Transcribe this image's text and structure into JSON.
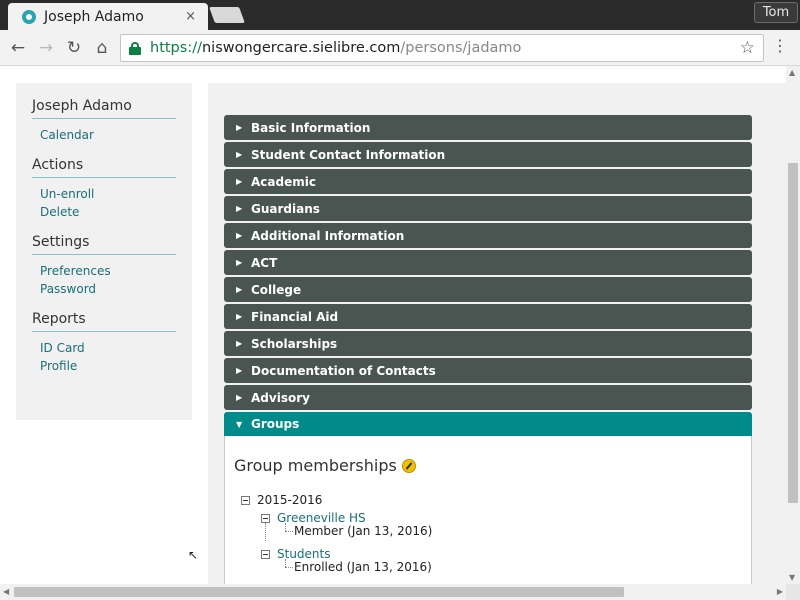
{
  "browser": {
    "tab_title": "Joseph Adamo",
    "tab_close": "×",
    "profile": "Tom",
    "url_scheme": "https://",
    "url_host": "niswongercare.sielibre.com",
    "url_path": "/persons/jadamo",
    "icons": {
      "back": "←",
      "forward": "→",
      "reload": "↻",
      "home": "⌂",
      "star": "☆",
      "menu": "⋮"
    }
  },
  "sidebar": {
    "sections": [
      {
        "heading": "Joseph Adamo",
        "links": [
          "Calendar"
        ]
      },
      {
        "heading": "Actions",
        "links": [
          "Un-enroll",
          "Delete"
        ]
      },
      {
        "heading": "Settings",
        "links": [
          "Preferences",
          "Password"
        ]
      },
      {
        "heading": "Reports",
        "links": [
          "ID Card",
          "Profile"
        ]
      }
    ]
  },
  "accordion": {
    "collapsed_arrow": "▶",
    "expanded_arrow": "▼",
    "items": [
      "Basic Information",
      "Student Contact Information",
      "Academic",
      "Guardians",
      "Additional Information",
      "ACT",
      "College",
      "Financial Aid",
      "Scholarships",
      "Documentation of Contacts",
      "Advisory"
    ],
    "open_item": "Groups"
  },
  "groups_panel": {
    "title": "Group memberships",
    "year": "2015-2016",
    "groups": [
      {
        "name": "Greeneville HS",
        "membership": "Member (Jan 13, 2016)"
      },
      {
        "name": "Students",
        "membership": "Enrolled (Jan 13, 2016)"
      }
    ]
  },
  "colors": {
    "accordion_bar": "#4a5552",
    "accordion_open": "#008b8b",
    "link": "#1a6f7a",
    "url_secure": "#0b8043"
  }
}
